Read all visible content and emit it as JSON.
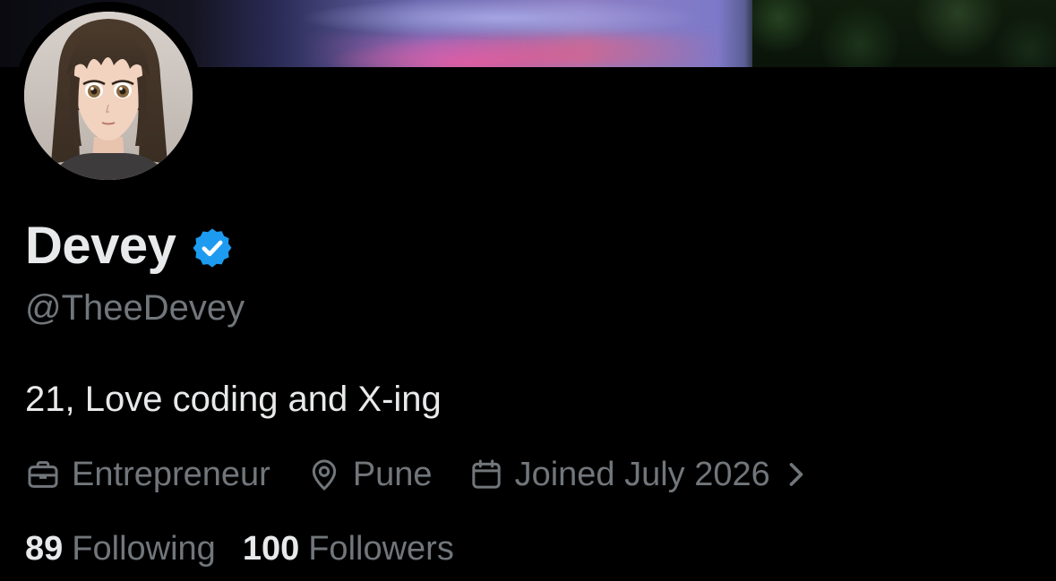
{
  "profile": {
    "display_name": "Devey",
    "verified": true,
    "handle": "@TheeDevey",
    "bio": "21, Love coding and X-ing",
    "profession": "Entrepreneur",
    "location": "Pune",
    "joined": "Joined July 2026",
    "following_count": "89",
    "following_label": "Following",
    "followers_count": "100",
    "followers_label": "Followers"
  },
  "icons": {
    "verified": "verified-badge-icon",
    "profession": "briefcase-icon",
    "location": "location-pin-icon",
    "joined": "calendar-icon",
    "chevron": "chevron-right-icon"
  },
  "colors": {
    "background": "#000000",
    "primary_text": "#e7e9ea",
    "secondary_text": "#71767b",
    "verified_blue": "#1d9bf0"
  }
}
